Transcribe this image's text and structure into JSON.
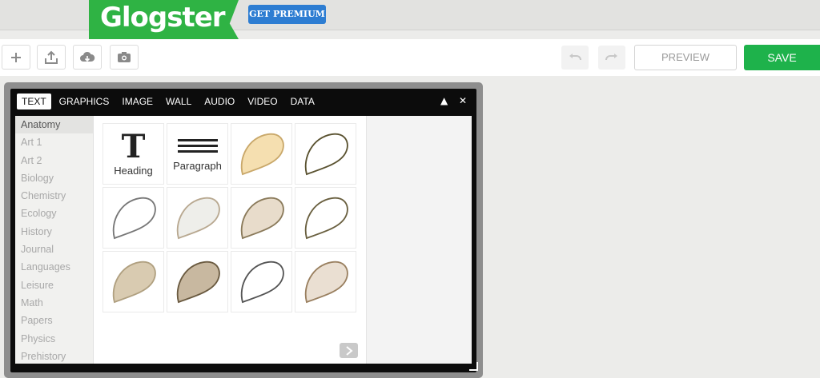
{
  "header": {
    "logo_text": "Glogster",
    "premium_label": "GET PREMIUM"
  },
  "toolbar": {
    "add_icon": "plus-icon",
    "upload_icon": "upload-icon",
    "download_icon": "cloud-download-icon",
    "camera_icon": "camera-icon",
    "undo_icon": "undo-icon",
    "redo_icon": "redo-icon",
    "preview_label": "PREVIEW",
    "save_label": "SAVE"
  },
  "panel": {
    "tabs": [
      {
        "label": "TEXT",
        "active": true
      },
      {
        "label": "GRAPHICS"
      },
      {
        "label": "IMAGE"
      },
      {
        "label": "WALL"
      },
      {
        "label": "AUDIO"
      },
      {
        "label": "VIDEO"
      },
      {
        "label": "DATA"
      }
    ],
    "collapse_icon": "▲",
    "close_icon": "✕",
    "categories": [
      "Anatomy",
      "Art 1",
      "Art 2",
      "Biology",
      "Chemistry",
      "Ecology",
      "History",
      "Journal",
      "Languages",
      "Leisure",
      "Math",
      "Papers",
      "Physics",
      "Prehistory"
    ],
    "active_category": "Anatomy",
    "tiles": [
      {
        "kind": "heading",
        "label": "Heading",
        "glyph": "T"
      },
      {
        "kind": "paragraph",
        "label": "Paragraph"
      },
      {
        "kind": "bubble",
        "fill": "#f5dfb0",
        "stroke": "#c9a86a"
      },
      {
        "kind": "bubble",
        "fill": "#ffffff",
        "stroke": "#5a5230"
      },
      {
        "kind": "bubble",
        "fill": "#ffffff",
        "stroke": "#777777"
      },
      {
        "kind": "bubble",
        "fill": "#eeeeea",
        "stroke": "#b8a890"
      },
      {
        "kind": "bubble",
        "fill": "#e8dccb",
        "stroke": "#8a7a5a"
      },
      {
        "kind": "bubble",
        "fill": "#ffffff",
        "stroke": "#6a6040"
      },
      {
        "kind": "bubble",
        "fill": "#d9cbb1",
        "stroke": "#b0a080"
      },
      {
        "kind": "bubble",
        "fill": "#c8b8a0",
        "stroke": "#6a5a40"
      },
      {
        "kind": "bubble",
        "fill": "#ffffff",
        "stroke": "#555555"
      },
      {
        "kind": "bubble",
        "fill": "#eadfd2",
        "stroke": "#9a8060"
      }
    ],
    "next_icon": "chevron-right-icon"
  }
}
